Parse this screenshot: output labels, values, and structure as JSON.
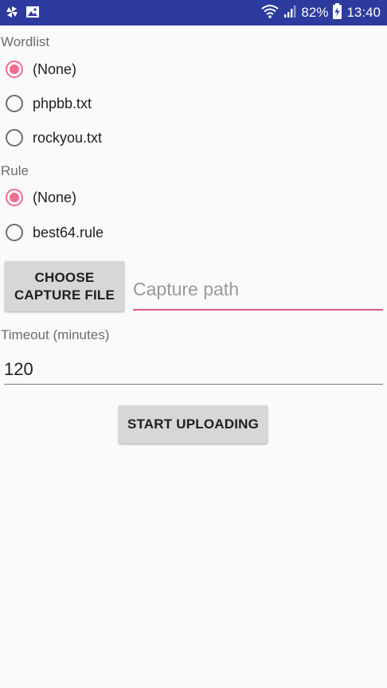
{
  "status_bar": {
    "battery_percent": "82%",
    "time": "13:40",
    "left_icons": [
      "pinwheel-icon",
      "image-icon"
    ],
    "right_icons": [
      "wifi-icon",
      "signal-icon",
      "battery-charging-icon"
    ]
  },
  "wordlist": {
    "label": "Wordlist",
    "options": [
      {
        "label": "(None)",
        "checked": true
      },
      {
        "label": "phpbb.txt",
        "checked": false
      },
      {
        "label": "rockyou.txt",
        "checked": false
      }
    ]
  },
  "rule": {
    "label": "Rule",
    "options": [
      {
        "label": "(None)",
        "checked": true
      },
      {
        "label": "best64.rule",
        "checked": false
      }
    ]
  },
  "capture": {
    "button_line1": "CHOOSE",
    "button_line2": "CAPTURE FILE",
    "path_placeholder": "Capture path",
    "path_value": ""
  },
  "timeout": {
    "label": "Timeout (minutes)",
    "value": "120"
  },
  "start_button": "START UPLOADING",
  "colors": {
    "status_bar": "#2d3a9e",
    "accent": "#f06d92",
    "input_underline": "#d95a7e",
    "button_bg": "#d6d7d7",
    "background": "#fafafa"
  }
}
